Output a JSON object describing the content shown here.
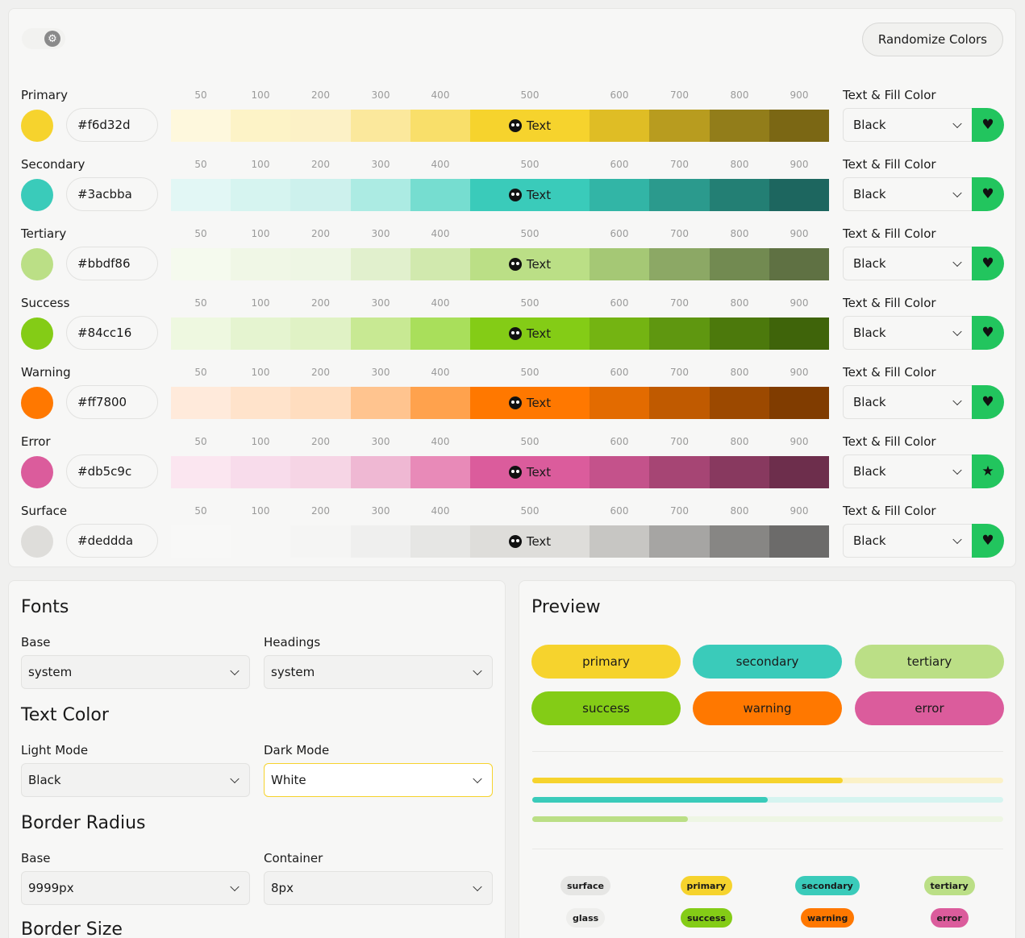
{
  "toolbar": {
    "mode_icon": "gear-icon",
    "randomize_label": "Randomize Colors"
  },
  "scale_steps": [
    "50",
    "100",
    "200",
    "300",
    "400",
    "500",
    "600",
    "700",
    "800",
    "900"
  ],
  "swatch_text": "Text",
  "text_fill_label": "Text & Fill Color",
  "palettes": [
    {
      "name": "Primary",
      "hex": "#f6d32d",
      "fill": "Black",
      "icon": "heart-icon",
      "glyph": "♥",
      "shades": [
        "#fef8dd",
        "#fdf3c7",
        "#fcf1c6",
        "#fbe89c",
        "#f9df6a",
        "#f6d32d",
        "#dfbd25",
        "#b89c1f",
        "#927d1a",
        "#7b6714"
      ]
    },
    {
      "name": "Secondary",
      "hex": "#3acbba",
      "fill": "Black",
      "icon": "heart-icon",
      "glyph": "♥",
      "shades": [
        "#e2f7f5",
        "#d6f4f0",
        "#cdf1ed",
        "#acebe3",
        "#76ddd0",
        "#3acbba",
        "#32b5a6",
        "#2b9a8d",
        "#237f74",
        "#1d665f"
      ]
    },
    {
      "name": "Tertiary",
      "hex": "#bbdf86",
      "fill": "Black",
      "icon": "heart-icon",
      "glyph": "♥",
      "shades": [
        "#f5faee",
        "#f0f7e6",
        "#eef6e4",
        "#e1f0cd",
        "#d1e9ae",
        "#bbdf86",
        "#a5c875",
        "#8ca865",
        "#728a51",
        "#5f7143"
      ]
    },
    {
      "name": "Success",
      "hex": "#84cc16",
      "fill": "Black",
      "icon": "heart-icon",
      "glyph": "♥",
      "shades": [
        "#eef8e0",
        "#e5f4d0",
        "#e0f2c5",
        "#c8e993",
        "#a9df5b",
        "#84cc16",
        "#74b412",
        "#5f9710",
        "#4c790c",
        "#3f640a"
      ]
    },
    {
      "name": "Warning",
      "hex": "#ff7800",
      "fill": "Black",
      "icon": "heart-icon",
      "glyph": "♥",
      "shades": [
        "#ffeadb",
        "#ffe3cb",
        "#ffddbf",
        "#ffc48f",
        "#ffa24d",
        "#ff7800",
        "#e36b00",
        "#c05a00",
        "#9c4900",
        "#803c00"
      ]
    },
    {
      "name": "Error",
      "hex": "#db5c9c",
      "fill": "Black",
      "icon": "star-icon",
      "glyph": "★",
      "shades": [
        "#fbe6f0",
        "#f8dceb",
        "#f6d5e5",
        "#efb8d3",
        "#e88ab8",
        "#db5c9c",
        "#c4528b",
        "#a64574",
        "#88395f",
        "#6d2e4c"
      ]
    },
    {
      "name": "Surface",
      "hex": "#deddda",
      "fill": "Black",
      "icon": "heart-icon",
      "glyph": "♥",
      "shades": [
        "#f8f8f7",
        "#f7f7f6",
        "#f5f5f4",
        "#efefee",
        "#e6e6e4",
        "#deddda",
        "#c7c6c3",
        "#a6a5a3",
        "#878684",
        "#6c6b6a"
      ]
    }
  ],
  "fonts": {
    "title": "Fonts",
    "base_label": "Base",
    "base_value": "system",
    "headings_label": "Headings",
    "headings_value": "system",
    "text_color_title": "Text Color",
    "light_label": "Light Mode",
    "light_value": "Black",
    "dark_label": "Dark Mode",
    "dark_value": "White",
    "radius_title": "Border Radius",
    "radius_base_label": "Base",
    "radius_base_value": "9999px",
    "radius_container_label": "Container",
    "radius_container_value": "8px",
    "border_size_title": "Border Size"
  },
  "preview": {
    "title": "Preview",
    "buttons": [
      {
        "label": "primary",
        "color": "#f6d32d"
      },
      {
        "label": "secondary",
        "color": "#3acbba"
      },
      {
        "label": "tertiary",
        "color": "#bbdf86"
      },
      {
        "label": "success",
        "color": "#84cc16"
      },
      {
        "label": "warning",
        "color": "#ff7800"
      },
      {
        "label": "error",
        "color": "#db5c9c"
      }
    ],
    "progress": [
      {
        "name": "primary",
        "value": 0.66,
        "color": "#f6d32d",
        "track": "#fbf1c7"
      },
      {
        "name": "secondary",
        "value": 0.5,
        "color": "#3acbba",
        "track": "#d6f4f0"
      },
      {
        "name": "tertiary",
        "value": 0.33,
        "color": "#bbdf86",
        "track": "#eef6e4"
      }
    ],
    "chips": [
      {
        "label": "surface",
        "color": "#e6e6e4"
      },
      {
        "label": "primary",
        "color": "#f6d32d"
      },
      {
        "label": "secondary",
        "color": "#3acbba"
      },
      {
        "label": "tertiary",
        "color": "#bbdf86"
      },
      {
        "label": "glass",
        "color": "#eeeeec"
      },
      {
        "label": "success",
        "color": "#84cc16"
      },
      {
        "label": "warning",
        "color": "#ff7800"
      },
      {
        "label": "error",
        "color": "#db5c9c"
      }
    ]
  }
}
